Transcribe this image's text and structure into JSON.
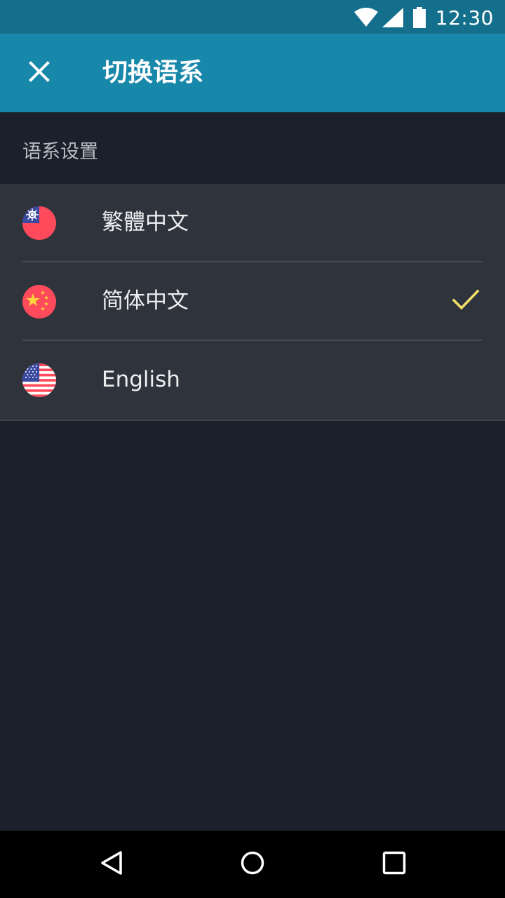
{
  "status_bar": {
    "time": "12:30",
    "icons": [
      "wifi-icon",
      "signal-icon",
      "battery-icon"
    ]
  },
  "app_bar": {
    "close_icon": "close-icon",
    "title": "切换语系"
  },
  "section": {
    "header": "语系设置"
  },
  "languages": [
    {
      "label": "繁體中文",
      "flag": "taiwan-flag-icon",
      "selected": false
    },
    {
      "label": "简体中文",
      "flag": "china-flag-icon",
      "selected": true
    },
    {
      "label": "English",
      "flag": "us-flag-icon",
      "selected": false
    }
  ],
  "nav_bar": {
    "icons": [
      "back-icon",
      "home-icon",
      "recents-icon"
    ]
  },
  "colors": {
    "status_bar": "#136f8b",
    "app_bar": "#1787aa",
    "background": "#1b212c",
    "list_background": "#2e333c",
    "check_accent": "#f2e06a"
  }
}
